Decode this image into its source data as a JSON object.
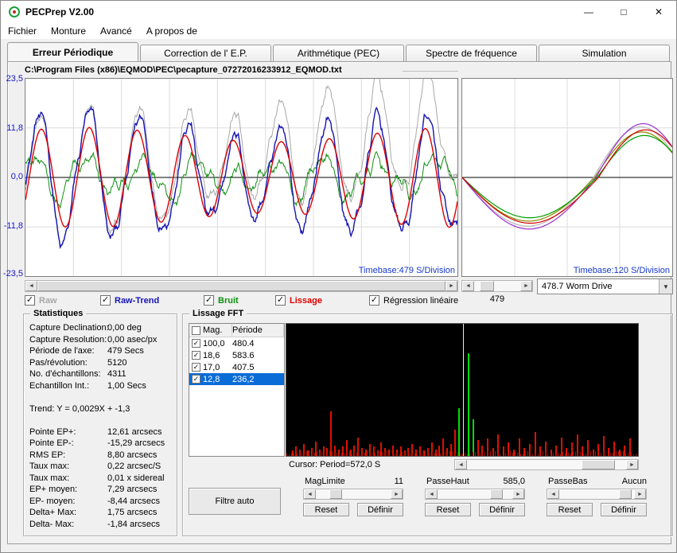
{
  "window": {
    "title": "PECPrep V2.00",
    "buttons": {
      "minimize": "—",
      "maximize": "□",
      "close": "✕"
    }
  },
  "menu": {
    "items": [
      "Fichier",
      "Monture",
      "Avancé",
      "A propos de"
    ]
  },
  "tabs": {
    "items": [
      {
        "label": "Erreur Périodique",
        "active": true
      },
      {
        "label": "Correction de l' E.P.",
        "active": false
      },
      {
        "label": "Arithmétique (PEC)",
        "active": false
      },
      {
        "label": "Spectre de fréquence",
        "active": false
      },
      {
        "label": "Simulation",
        "active": false
      }
    ]
  },
  "file_path": "C:\\Program Files (x86)\\EQMOD\\PEC\\pecapture_07272016233912_EQMOD.txt",
  "main_chart": {
    "y_axis_labels": [
      "23,5",
      "11,8",
      "0,0",
      "-11,8",
      "-23,5"
    ],
    "timebase_label": "Timebase:479 S/Division",
    "y_max": 23.5,
    "period_s": 479,
    "total_s": 4311,
    "divisions": 9,
    "trend_slope": 0.0029,
    "trend_offset": -1.3
  },
  "overlay_chart": {
    "timebase_label": "Timebase:120 S/Division",
    "scroll_value": "479",
    "combo_value": "478.7 Worm Drive",
    "divisions": 4
  },
  "toggles": [
    {
      "label": "Raw",
      "color": "#a8a8a8",
      "checked": true,
      "bold": true
    },
    {
      "label": "Raw-Trend",
      "color": "#1414b4",
      "checked": true,
      "bold": true
    },
    {
      "label": "Bruit",
      "color": "#0f8f0f",
      "checked": true,
      "bold": true
    },
    {
      "label": "Lissage",
      "color": "#dd0000",
      "checked": true,
      "bold": true
    },
    {
      "label": "Régression linéaire",
      "color": "#000000",
      "checked": true,
      "bold": false
    }
  ],
  "statistics": {
    "title": "Statistiques",
    "rows": [
      {
        "label": "Capture Declination:",
        "value": "0,00 deg"
      },
      {
        "label": "Capture Resolution:",
        "value": "0,00 asec/px"
      },
      {
        "label": "Période de l'axe:",
        "value": "479 Secs"
      },
      {
        "label": "Pas/révolution:",
        "value": "5120"
      },
      {
        "label": "No. d'échantillons:",
        "value": "4311"
      },
      {
        "label": "Echantillon Int.:",
        "value": "1,00 Secs"
      },
      {
        "label": "",
        "value": ""
      },
      {
        "label": "Trend: Y = 0,0029X + -1,3",
        "value": ""
      },
      {
        "label": "",
        "value": ""
      },
      {
        "label": "Pointe EP+:",
        "value": "12,61 arcsecs"
      },
      {
        "label": "Pointe EP-:",
        "value": "-15,29 arcsecs"
      },
      {
        "label": "RMS EP:",
        "value": "8,80 arcsecs"
      },
      {
        "label": "Taux max:",
        "value": "0,22 arcsec/S"
      },
      {
        "label": "Taux max:",
        "value": "0,01 x sidereal"
      },
      {
        "label": "EP+ moyen:",
        "value": "7,29 arcsecs"
      },
      {
        "label": "EP- moyen:",
        "value": "-8,44 arcsecs"
      },
      {
        "label": "Delta+ Max:",
        "value": "1,75 arcsecs"
      },
      {
        "label": "Delta- Max:",
        "value": "-1,84 arcsecs"
      }
    ]
  },
  "fft": {
    "title": "Lissage FFT",
    "table": {
      "header": {
        "mag": "Mag.",
        "period": "Période"
      },
      "rows": [
        {
          "checked": true,
          "mag": "100,0",
          "period": "480.4",
          "selected": false
        },
        {
          "checked": true,
          "mag": "18,6",
          "period": "583.6",
          "selected": false
        },
        {
          "checked": true,
          "mag": "17,0",
          "period": "407.5",
          "selected": false
        },
        {
          "checked": true,
          "mag": "12,8",
          "period": "236,2",
          "selected": true
        }
      ]
    },
    "cursor_label": "Cursor: Period=572,0 S",
    "filtre_auto_label": "Filtre auto",
    "reset_label": "Reset",
    "definir_label": "Définir",
    "controls": [
      {
        "name": "MagLimite",
        "value": "11"
      },
      {
        "name": "PasseHaut",
        "value": "585,0"
      },
      {
        "name": "PasseBas",
        "value": "Aucun"
      }
    ],
    "spectrum": {
      "cursor_x_pct": 50.3,
      "bars": [
        [
          1.5,
          4,
          0
        ],
        [
          2.6,
          7,
          0
        ],
        [
          3.7,
          5,
          0
        ],
        [
          4.8,
          9,
          0
        ],
        [
          5.9,
          4,
          0
        ],
        [
          7.0,
          6,
          0
        ],
        [
          8.1,
          11,
          0
        ],
        [
          9.2,
          5,
          0
        ],
        [
          10.3,
          7,
          0
        ],
        [
          11.4,
          6,
          0
        ],
        [
          12.5,
          34,
          0
        ],
        [
          13.6,
          8,
          0
        ],
        [
          14.7,
          5,
          0
        ],
        [
          15.8,
          7,
          0
        ],
        [
          16.9,
          12,
          0
        ],
        [
          18.0,
          5,
          0
        ],
        [
          19.1,
          8,
          0
        ],
        [
          20.2,
          14,
          0
        ],
        [
          21.3,
          6,
          0
        ],
        [
          22.4,
          5,
          0
        ],
        [
          23.5,
          9,
          0
        ],
        [
          24.6,
          7,
          0
        ],
        [
          25.7,
          4,
          0
        ],
        [
          26.8,
          10,
          0
        ],
        [
          27.9,
          6,
          0
        ],
        [
          29.0,
          5,
          0
        ],
        [
          30.1,
          8,
          0
        ],
        [
          31.2,
          5,
          0
        ],
        [
          32.3,
          7,
          0
        ],
        [
          33.4,
          4,
          0
        ],
        [
          34.5,
          6,
          0
        ],
        [
          35.6,
          9,
          0
        ],
        [
          36.7,
          5,
          0
        ],
        [
          37.8,
          7,
          0
        ],
        [
          38.9,
          4,
          0
        ],
        [
          40.0,
          6,
          0
        ],
        [
          41.1,
          10,
          0
        ],
        [
          42.2,
          5,
          0
        ],
        [
          43.3,
          8,
          0
        ],
        [
          44.4,
          13,
          0
        ],
        [
          45.5,
          6,
          0
        ],
        [
          46.6,
          9,
          0
        ],
        [
          47.7,
          20,
          0
        ],
        [
          48.9,
          36,
          1
        ],
        [
          51.6,
          78,
          1
        ],
        [
          52.9,
          28,
          1
        ],
        [
          54.2,
          12,
          0
        ],
        [
          55.5,
          8,
          0
        ],
        [
          57.0,
          13,
          0
        ],
        [
          58.5,
          6,
          0
        ],
        [
          60.0,
          16,
          0
        ],
        [
          61.5,
          7,
          0
        ],
        [
          63.0,
          10,
          0
        ],
        [
          64.5,
          5,
          0
        ],
        [
          66.0,
          13,
          0
        ],
        [
          67.5,
          6,
          0
        ],
        [
          69.0,
          9,
          0
        ],
        [
          70.5,
          18,
          0
        ],
        [
          72.0,
          7,
          0
        ],
        [
          73.5,
          11,
          0
        ],
        [
          75.0,
          5,
          0
        ],
        [
          76.5,
          8,
          0
        ],
        [
          78.0,
          14,
          0
        ],
        [
          79.5,
          6,
          0
        ],
        [
          81.0,
          10,
          0
        ],
        [
          82.5,
          16,
          0
        ],
        [
          84.0,
          7,
          0
        ],
        [
          85.5,
          12,
          0
        ],
        [
          87.0,
          5,
          0
        ],
        [
          88.5,
          9,
          0
        ],
        [
          90.0,
          15,
          0
        ],
        [
          91.5,
          6,
          0
        ],
        [
          93.0,
          11,
          0
        ],
        [
          94.5,
          5,
          0
        ],
        [
          96.0,
          8,
          0
        ],
        [
          97.5,
          13,
          0
        ]
      ]
    }
  }
}
